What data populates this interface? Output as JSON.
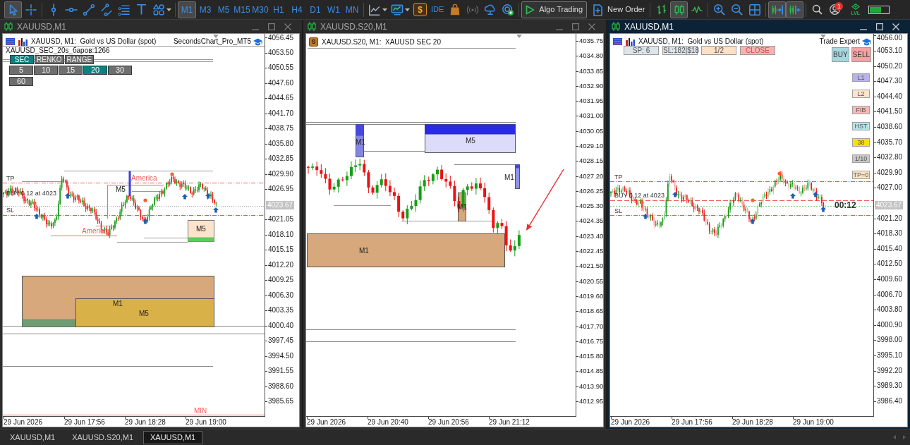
{
  "toolbar": {
    "drawing_tools": [
      {
        "selected": true
      },
      {
        "selected": false
      },
      {
        "selected": false
      },
      {
        "selected": false
      },
      {
        "selected": false
      },
      {
        "selected": false
      },
      {
        "selected": false
      },
      {
        "selected": false
      },
      {
        "selected": false
      }
    ],
    "timeframes": [
      {
        "label": "M1",
        "selected": true
      },
      {
        "label": "M3",
        "selected": false
      },
      {
        "label": "M5",
        "selected": false
      },
      {
        "label": "M15",
        "selected": false
      },
      {
        "label": "M30",
        "selected": false
      },
      {
        "label": "H1",
        "selected": false
      },
      {
        "label": "H4",
        "selected": false
      },
      {
        "label": "D1",
        "selected": false
      },
      {
        "label": "W1",
        "selected": false
      },
      {
        "label": "MN",
        "selected": false
      }
    ],
    "market_button": "$",
    "ide_button": "IDE",
    "algo_trading": {
      "label": "Algo Trading",
      "on": true
    },
    "new_order": "New Order",
    "chart_types": [
      {
        "selected": false
      },
      {
        "selected": true
      },
      {
        "selected": false
      }
    ],
    "chart_options": [
      {
        "selected": true
      },
      {
        "selected": true
      }
    ],
    "account_badge": "1",
    "level_button": "LVL"
  },
  "windows": [
    {
      "title": "XAUUSD,M1",
      "active": false,
      "chart": {
        "header": "XAUUSD, M1:  Gold vs US Dollar (spot)",
        "expert": "SecondsChart_Pro_MT5",
        "info": "XAUUSD_SEC_20s_баров:1266",
        "mode_buttons": [
          {
            "label": "SEC",
            "selected": true
          },
          {
            "label": "RENKO",
            "selected": false
          },
          {
            "label": "RANGE",
            "selected": false
          }
        ],
        "period_buttons": [
          {
            "label": "5",
            "selected": false
          },
          {
            "label": "10",
            "selected": false
          },
          {
            "label": "15",
            "selected": false
          },
          {
            "label": "20",
            "selected": true
          },
          {
            "label": "30",
            "selected": false
          },
          {
            "label": "60",
            "selected": false
          }
        ],
        "labels": [
          {
            "kind": "marker",
            "text": "TP"
          },
          {
            "kind": "session",
            "text": "America"
          },
          {
            "kind": "zone",
            "text": "M5"
          },
          {
            "kind": "marker",
            "text": "BUY 0.12 at 4023"
          },
          {
            "kind": "marker",
            "text": "SL"
          },
          {
            "kind": "zone",
            "text": "M5"
          },
          {
            "kind": "session",
            "text": "America"
          },
          {
            "kind": "zone",
            "text": "M1"
          },
          {
            "kind": "zone",
            "text": "M5"
          },
          {
            "kind": "level",
            "text": "MIN"
          }
        ],
        "price_axis": [
          "4056.45",
          "4053.50",
          "4050.55",
          "4047.60",
          "4044.65",
          "4041.70",
          "4038.75",
          "4035.80",
          "4032.85",
          "4029.90",
          "4026.95",
          "4021.05",
          "4018.10",
          "4015.15",
          "4012.20",
          "4009.25",
          "4006.30",
          "4003.35",
          "4000.40",
          "3997.45",
          "3994.50",
          "3991.55",
          "3988.60",
          "3985.65"
        ],
        "price_tag": "4023.67",
        "time_axis": [
          "29 Jun 2026",
          "29 Jun 17:56",
          "29 Jun 18:28",
          "29 Jun 19:00"
        ]
      }
    },
    {
      "title": "XAUUSD.S20,M1",
      "active": false,
      "chart": {
        "script_badge": "S",
        "header": "XAUUSD.S20, M1:  XAUUSD SEC 20",
        "labels": [
          {
            "kind": "zone",
            "text": "M1"
          },
          {
            "kind": "zone",
            "text": "M5"
          },
          {
            "kind": "zone",
            "text": "M1"
          },
          {
            "kind": "zone",
            "text": "M1"
          },
          {
            "kind": "zone",
            "text": "M1"
          }
        ],
        "price_axis": [
          "4035.75",
          "4034.80",
          "4033.85",
          "4032.90",
          "4031.95",
          "4031.00",
          "4030.05",
          "4029.10",
          "4028.15",
          "4027.20",
          "4026.25",
          "4025.30",
          "4024.35",
          "4023.40",
          "4022.45",
          "4021.50",
          "4020.55",
          "4019.60",
          "4018.65",
          "4017.70",
          "4016.75",
          "4015.80",
          "4014.85",
          "4013.90",
          "4012.95"
        ],
        "time_axis": [
          "29 Jun 2026",
          "29 Jun 20:40",
          "29 Jun 20:56",
          "29 Jun 21:12"
        ]
      }
    },
    {
      "title": "XAUUSD,M1",
      "active": true,
      "chart": {
        "header": "XAUUSD, M1:  Gold vs US Dollar (spot)",
        "expert": "Trade Expert",
        "trade_buttons": [
          {
            "label": "SP: 6",
            "color": "#dce5ea"
          },
          {
            "label": "SL:182|$18",
            "color": "#dce5ea"
          },
          {
            "label": "1/2",
            "color": "#fde1c7"
          },
          {
            "label": "CLOSE",
            "color": "#f7b3b3"
          }
        ],
        "order_buttons": [
          {
            "label": "BUY",
            "color": "#a7d7de"
          },
          {
            "label": "SELL",
            "color": "#f2a3a3"
          }
        ],
        "side_buttons": [
          {
            "label": "L1",
            "color": "#b8b2ee"
          },
          {
            "label": "L2",
            "color": "#fde3cc"
          },
          {
            "label": "FIB",
            "color": "#f8bab6"
          },
          {
            "label": "HST",
            "color": "#b7e3ea"
          },
          {
            "label": "38",
            "color": "#f4e300"
          },
          {
            "label": "1/10",
            "color": "#c8c8c8"
          },
          {
            "label": "TP=0",
            "color": "#fde4c4"
          }
        ],
        "labels": [
          {
            "kind": "marker",
            "text": "TP"
          },
          {
            "kind": "marker",
            "text": "BUY 0.12 at 4023"
          },
          {
            "kind": "marker",
            "text": "SL"
          }
        ],
        "timer": "00:12",
        "price_axis": [
          "4056.00",
          "4053.10",
          "4050.20",
          "4047.30",
          "4044.40",
          "4041.50",
          "4038.60",
          "4035.70",
          "4032.80",
          "4029.90",
          "4027.00",
          "4021.20",
          "4018.30",
          "4015.40",
          "4012.50",
          "4009.60",
          "4006.70",
          "4003.80",
          "4000.90",
          "3998.00",
          "3995.10",
          "3992.20",
          "3989.30",
          "3986.40"
        ],
        "price_tag": "4023.67",
        "time_axis": [
          "29 Jun 2026",
          "29 Jun 17:56",
          "29 Jun 18:28",
          "29 Jun 19:00"
        ]
      }
    }
  ],
  "tabs": [
    {
      "label": "XAUUSD,M1",
      "selected": false
    },
    {
      "label": "XAUUSD.S20,M1",
      "selected": false
    },
    {
      "label": "XAUUSD,M1",
      "selected": true
    }
  ]
}
